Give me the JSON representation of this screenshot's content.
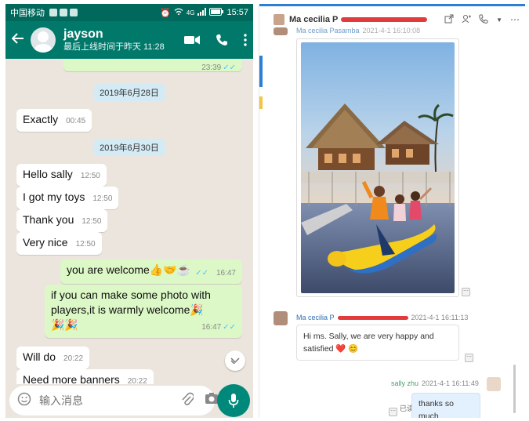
{
  "phone": {
    "status": {
      "carrier": "中国移动",
      "network": "4G",
      "time": "15:57"
    },
    "header": {
      "name": "jayson",
      "last_seen": "最后上线时间于昨天 11:28"
    },
    "messages": [
      {
        "dir": "out",
        "text": "",
        "time": "23:39",
        "read": true
      },
      {
        "dir": "date",
        "text": "2019年6月28日"
      },
      {
        "dir": "in",
        "text": "Exactly",
        "time": "00:45"
      },
      {
        "dir": "date",
        "text": "2019年6月30日"
      },
      {
        "dir": "in",
        "text": "Hello sally",
        "time": "12:50"
      },
      {
        "dir": "in",
        "text": "I got my toys",
        "time": "12:50"
      },
      {
        "dir": "in",
        "text": "Thank you",
        "time": "12:50"
      },
      {
        "dir": "in",
        "text": "Very nice",
        "time": "12:50"
      },
      {
        "dir": "out",
        "text": "you are welcome👍🤝☕",
        "time": "16:47",
        "read": true
      },
      {
        "dir": "out",
        "text": "if you can make some photo with players,it is warmly welcome🎉🎉🎉",
        "time": "16:47",
        "read": true
      },
      {
        "dir": "in",
        "text": "Will do",
        "time": "20:22"
      },
      {
        "dir": "in",
        "text": "Need more banners",
        "time": "20:22"
      }
    ],
    "input": {
      "placeholder": "输入消息"
    }
  },
  "desktop": {
    "contact_name": "Ma cecilia P",
    "photo_sender": "Ma cecilia Pasamba",
    "photo_time": "2021-4-1 16:10:08",
    "reply_sender": "Ma cecilia P",
    "reply_time": "2021-4-1 16:11:13",
    "reply_text": "Hi ms. Sally, we are very happy and satisfied ❤️ 😊",
    "me_name": "sally zhu",
    "me_time": "2021-4-1 16:11:49",
    "me_text": "thanks so much",
    "read_label": "已读",
    "photo_alt": "Children riding an inflatable banana boat in front of thatched water bungalows at sunset"
  },
  "colors": {
    "wa_header": "#00796b",
    "wa_status": "#00695c",
    "wa_out_bubble": "#dcf8c6",
    "wa_bg": "#ece5dd",
    "desk_accent": "#2b7fd5"
  }
}
